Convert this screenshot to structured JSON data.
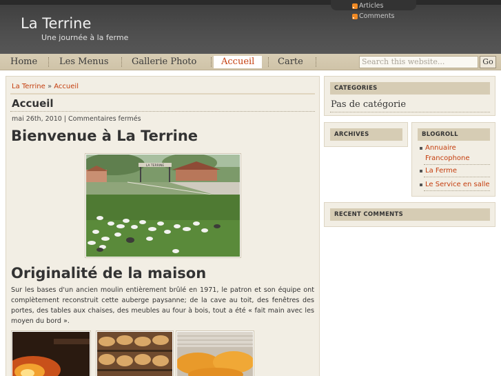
{
  "header": {
    "site_title": "La Terrine",
    "tagline": "Une journée à la ferme",
    "feeds": [
      {
        "label": "Articles",
        "icon": "rss-icon"
      },
      {
        "label": "Comments",
        "icon": "rss-icon"
      }
    ]
  },
  "nav": {
    "items": [
      {
        "label": "Home",
        "active": false
      },
      {
        "label": "Les Menus",
        "active": false
      },
      {
        "label": "Gallerie Photo",
        "active": false
      },
      {
        "label": "Accueil",
        "active": true
      },
      {
        "label": "Carte",
        "active": false
      }
    ],
    "search_placeholder": "Search this website...",
    "go_label": "Go"
  },
  "breadcrumb": {
    "home": "La Terrine",
    "separator": "»",
    "current": "Accueil"
  },
  "post": {
    "title": "Accueil",
    "meta": "mai 26th, 2010 | Commentaires fermés",
    "heading1": "Bienvenue à La Terrine",
    "heading2": "Originalité de la maison",
    "paragraph": "Sur les bases d'un ancien moulin entièrement brûlé en 1971, le patron et son équipe ont complètement reconstruit cette auberge paysanne; de la cave au toit, des fenêtres des portes, des tables aux chaises, des meubles au four à bois, tout a été « fait main avec les moyen du bord ».",
    "main_photo_sign": "LA TERRINE"
  },
  "sidebar": {
    "categories": {
      "title": "CATEGORIES",
      "text": "Pas de catégorie"
    },
    "archives": {
      "title": "ARCHIVES"
    },
    "blogroll": {
      "title": "BLOGROLL",
      "links": [
        "Annuaire Francophone",
        "La Ferme",
        "Le Service en salle"
      ]
    },
    "recent_comments": {
      "title": "RECENT COMMENTS"
    }
  },
  "colors": {
    "accent": "#c43d0d",
    "header_bg": "#4a4a4a",
    "nav_bg": "#d6ccb2",
    "content_bg": "#f2eee4",
    "box_head": "#d6ccb4"
  }
}
